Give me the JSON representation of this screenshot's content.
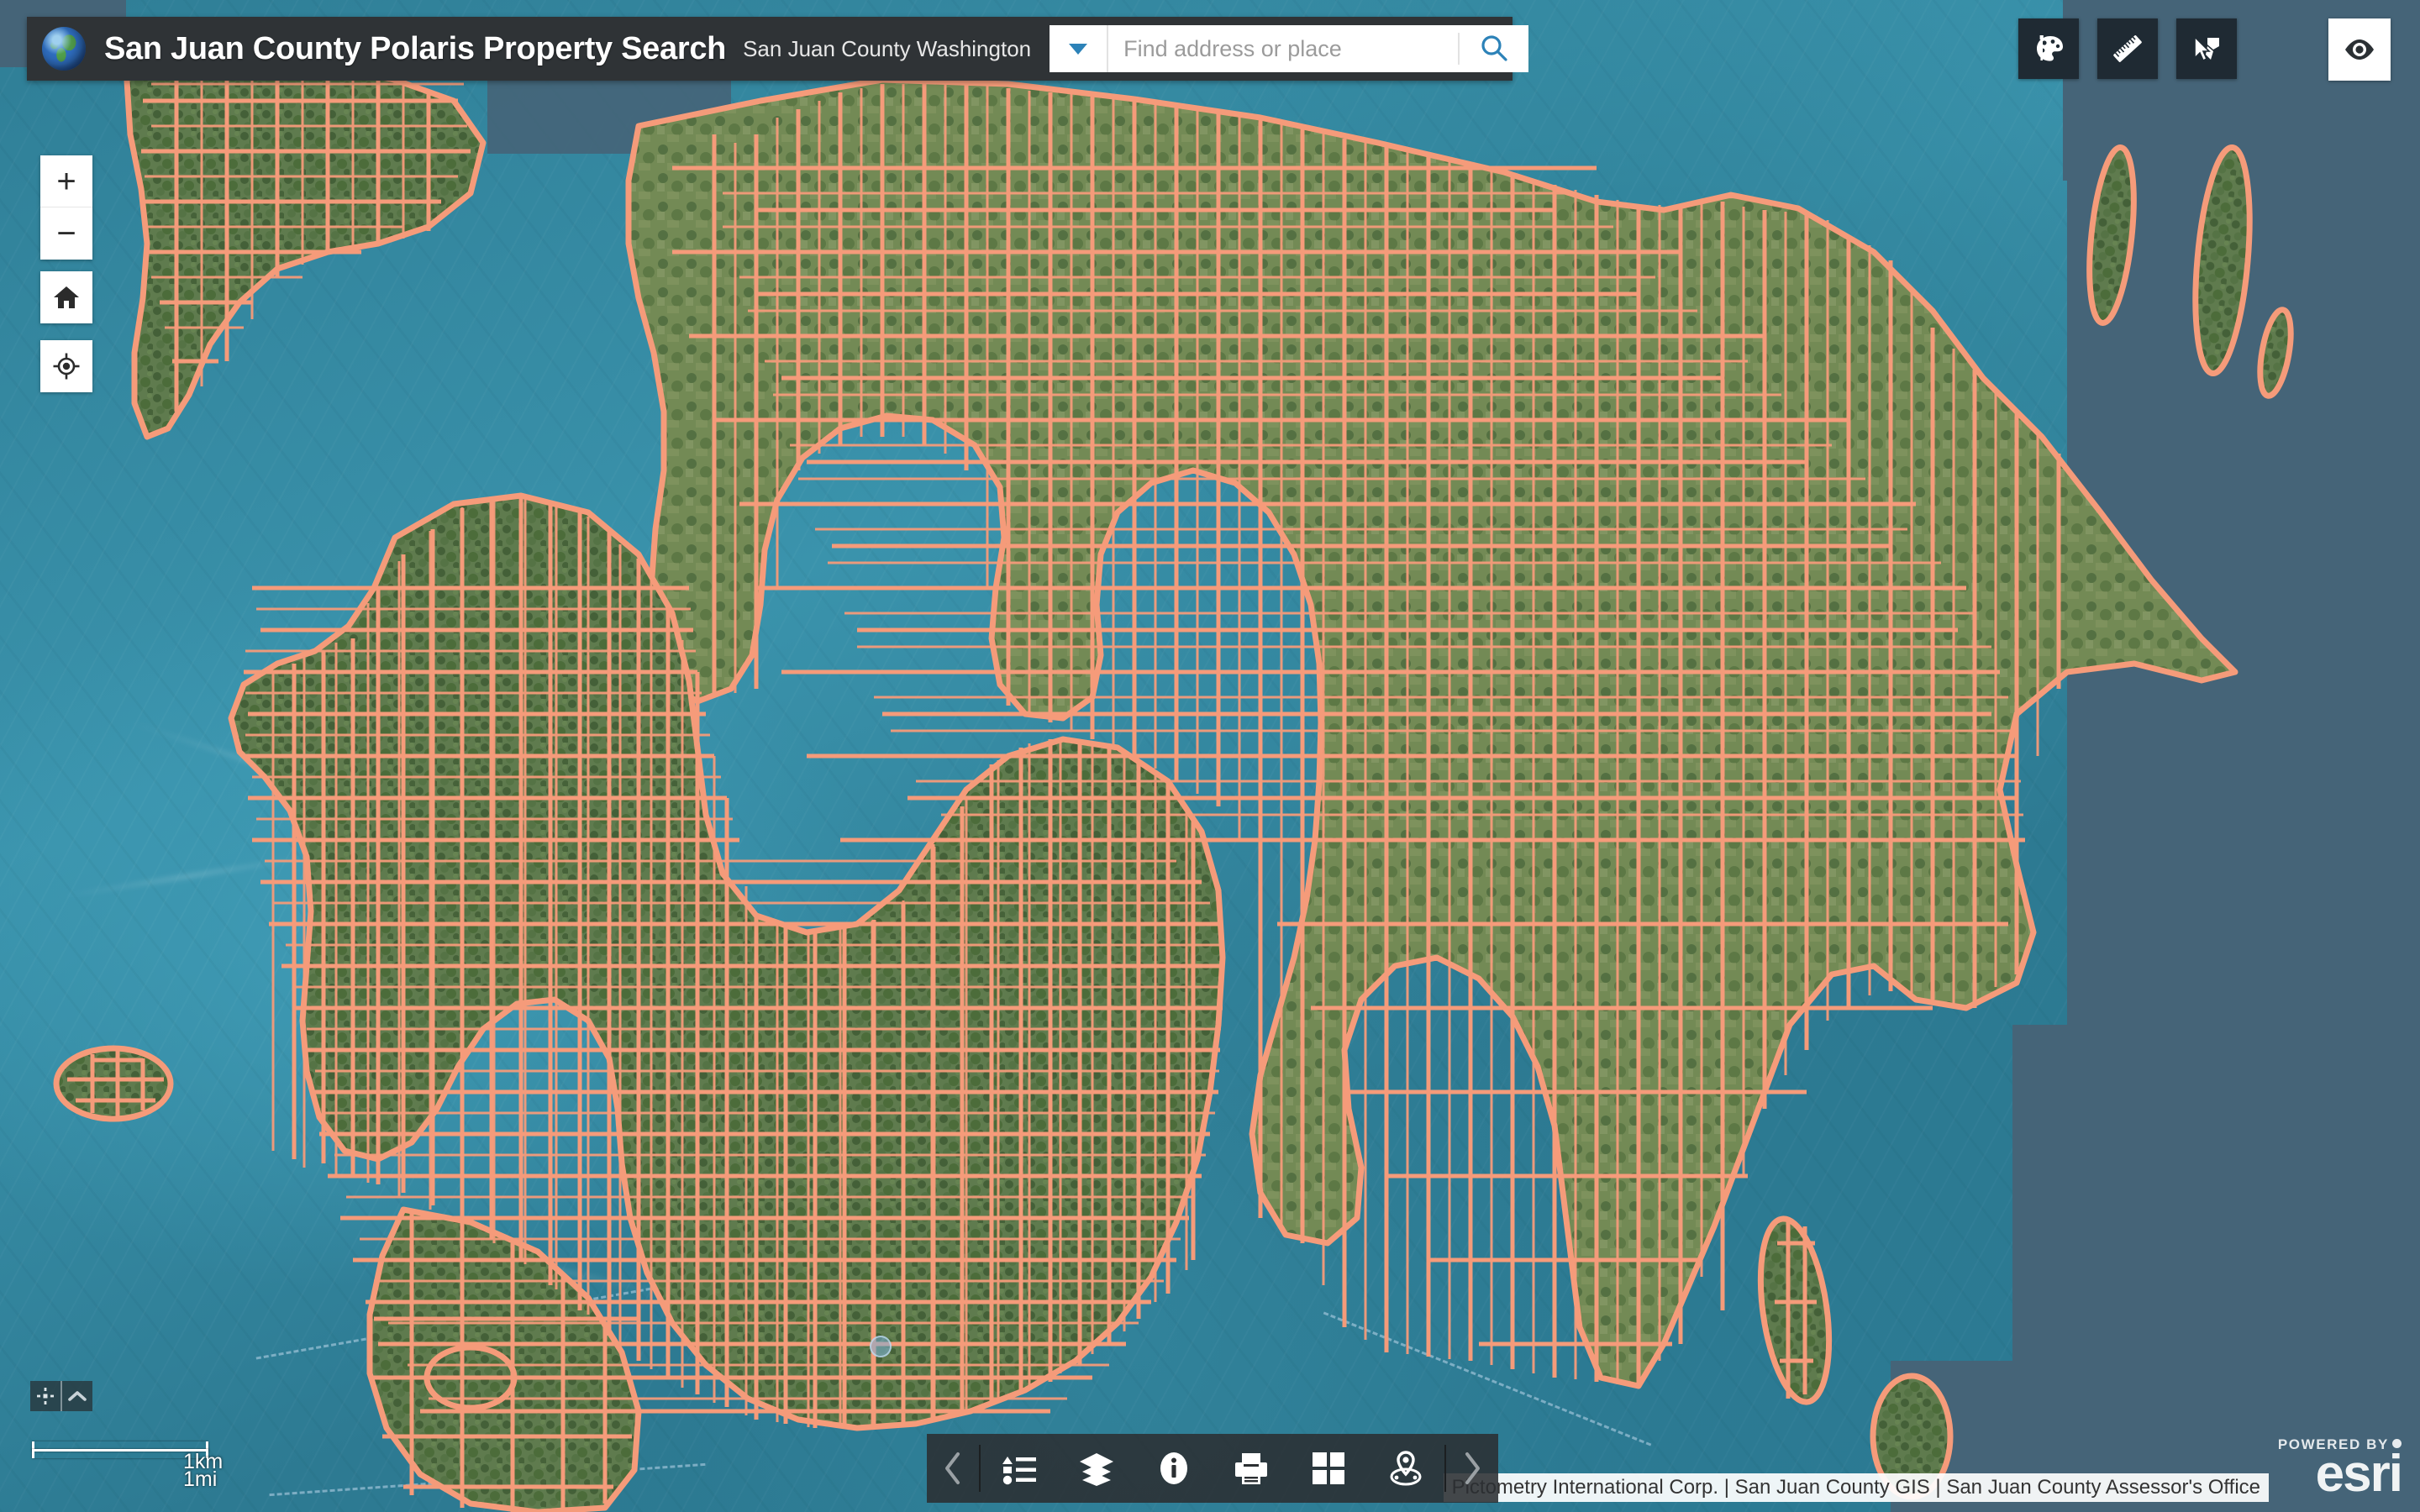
{
  "header": {
    "globe_icon": "globe-icon",
    "title": "San Juan County Polaris Property Search",
    "subtitle": "San Juan County Washington",
    "search": {
      "placeholder": "Find address or place",
      "value": "",
      "dropdown_icon": "chevron-down-icon",
      "search_icon": "search-icon"
    }
  },
  "top_right_tools": [
    {
      "name": "draw-button",
      "icon": "palette-icon",
      "label": "Draw"
    },
    {
      "name": "measure-button",
      "icon": "ruler-icon",
      "label": "Measure"
    },
    {
      "name": "select-button",
      "icon": "select-arrow-icon",
      "label": "Select"
    }
  ],
  "eye_button": {
    "name": "visibility-button",
    "icon": "eye-icon",
    "label": "Show/Hide"
  },
  "map_controls": {
    "zoom_in": {
      "label": "+",
      "icon": "plus-icon"
    },
    "zoom_out": {
      "label": "−",
      "icon": "minus-icon"
    },
    "home": {
      "icon": "home-icon",
      "label": "Default extent"
    },
    "locate": {
      "icon": "locate-crosshair-icon",
      "label": "Find my location"
    }
  },
  "bottom_toolbar": {
    "prev_icon": "chevron-left-icon",
    "next_icon": "chevron-right-icon",
    "items": [
      {
        "name": "legend-button",
        "icon": "legend-list-icon",
        "label": "Legend"
      },
      {
        "name": "layers-button",
        "icon": "layers-stack-icon",
        "label": "Layer List"
      },
      {
        "name": "info-button",
        "icon": "info-circle-icon",
        "label": "About"
      },
      {
        "name": "print-button",
        "icon": "printer-icon",
        "label": "Print"
      },
      {
        "name": "basemap-button",
        "icon": "basemap-grid-icon",
        "label": "Basemap Gallery"
      },
      {
        "name": "near-me-button",
        "icon": "map-pin-icon",
        "label": "Near Me"
      }
    ]
  },
  "coord_widget": {
    "coordinate_icon": "coordinate-crosshair-icon",
    "expand_icon": "chevron-up-icon"
  },
  "scalebar": {
    "distance_mi": "1mi",
    "distance_km": "1km"
  },
  "attribution": "Pictometry International Corp. | San Juan County GIS | San Juan County Assessor's Office",
  "esri": {
    "powered_by": "POWERED BY",
    "wordmark": "esri"
  },
  "colors": {
    "header_bg": "#2f3336",
    "tool_bg": "#1f2a33",
    "accent_blue": "#2c82b8",
    "parcel_outline": "#f59b7a",
    "water": "#3a93ac",
    "no_data_slate": "#456478",
    "land_green": "#5f7b4e"
  },
  "map": {
    "basemap": "aerial-imagery",
    "overlay_layer": "parcel-boundaries",
    "region": "San Juan County Washington"
  }
}
